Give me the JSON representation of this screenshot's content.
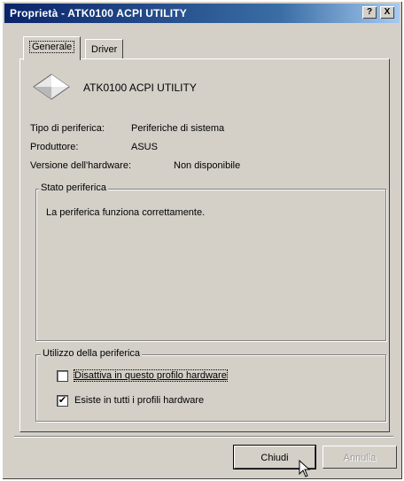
{
  "window": {
    "title": "Proprietà - ATK0100 ACPI UTILITY",
    "help_button": "?",
    "close_button": "X"
  },
  "tabs": [
    {
      "label": "Generale",
      "active": true
    },
    {
      "label": "Driver",
      "active": false
    }
  ],
  "device": {
    "name": "ATK0100 ACPI UTILITY",
    "icon": "device-diamond-icon",
    "properties": [
      {
        "label": "Tipo di periferica:",
        "value": "Periferiche di sistema"
      },
      {
        "label": "Produttore:",
        "value": "ASUS"
      },
      {
        "label": "Versione dell'hardware:",
        "value": "Non disponibile"
      }
    ]
  },
  "status_group": {
    "legend": "Stato periferica",
    "text": "La periferica funziona correttamente."
  },
  "usage_group": {
    "legend": "Utilizzo della periferica",
    "options": [
      {
        "label": "Disattiva in questo profilo hardware",
        "checked": false
      },
      {
        "label": "Esiste in tutti i profili hardware",
        "checked": true
      }
    ]
  },
  "buttons": {
    "close": "Chiudi",
    "cancel": "Annulla"
  }
}
